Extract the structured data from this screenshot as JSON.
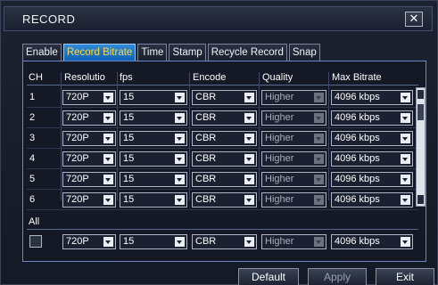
{
  "window": {
    "title": "RECORD",
    "close_glyph": "✕"
  },
  "tabs": [
    {
      "label": "Enable",
      "active": false
    },
    {
      "label": "Record Bitrate",
      "active": true
    },
    {
      "label": "Time",
      "active": false
    },
    {
      "label": "Stamp",
      "active": false
    },
    {
      "label": "Recycle Record",
      "active": false
    },
    {
      "label": "Snap",
      "active": false
    }
  ],
  "columns": [
    "CH",
    "Resolutio",
    "fps",
    "Encode",
    "Quality",
    "Max Bitrate"
  ],
  "rows": [
    {
      "ch": "1",
      "resolution": "720P",
      "fps": "15",
      "encode": "CBR",
      "quality": "Higher",
      "max_bitrate": "4096 kbps"
    },
    {
      "ch": "2",
      "resolution": "720P",
      "fps": "15",
      "encode": "CBR",
      "quality": "Higher",
      "max_bitrate": "4096 kbps"
    },
    {
      "ch": "3",
      "resolution": "720P",
      "fps": "15",
      "encode": "CBR",
      "quality": "Higher",
      "max_bitrate": "4096 kbps"
    },
    {
      "ch": "4",
      "resolution": "720P",
      "fps": "15",
      "encode": "CBR",
      "quality": "Higher",
      "max_bitrate": "4096 kbps"
    },
    {
      "ch": "5",
      "resolution": "720P",
      "fps": "15",
      "encode": "CBR",
      "quality": "Higher",
      "max_bitrate": "4096 kbps"
    },
    {
      "ch": "6",
      "resolution": "720P",
      "fps": "15",
      "encode": "CBR",
      "quality": "Higher",
      "max_bitrate": "4096 kbps"
    }
  ],
  "all": {
    "label": "All",
    "checked": false,
    "resolution": "720P",
    "fps": "15",
    "encode": "CBR",
    "quality": "Higher",
    "max_bitrate": "4096 kbps"
  },
  "buttons": {
    "default": "Default",
    "apply": "Apply",
    "exit": "Exit"
  },
  "colors": {
    "active_tab_bg": "#1a74c9",
    "active_tab_text": "#ffd94a",
    "panel_border": "#6c86c8"
  }
}
